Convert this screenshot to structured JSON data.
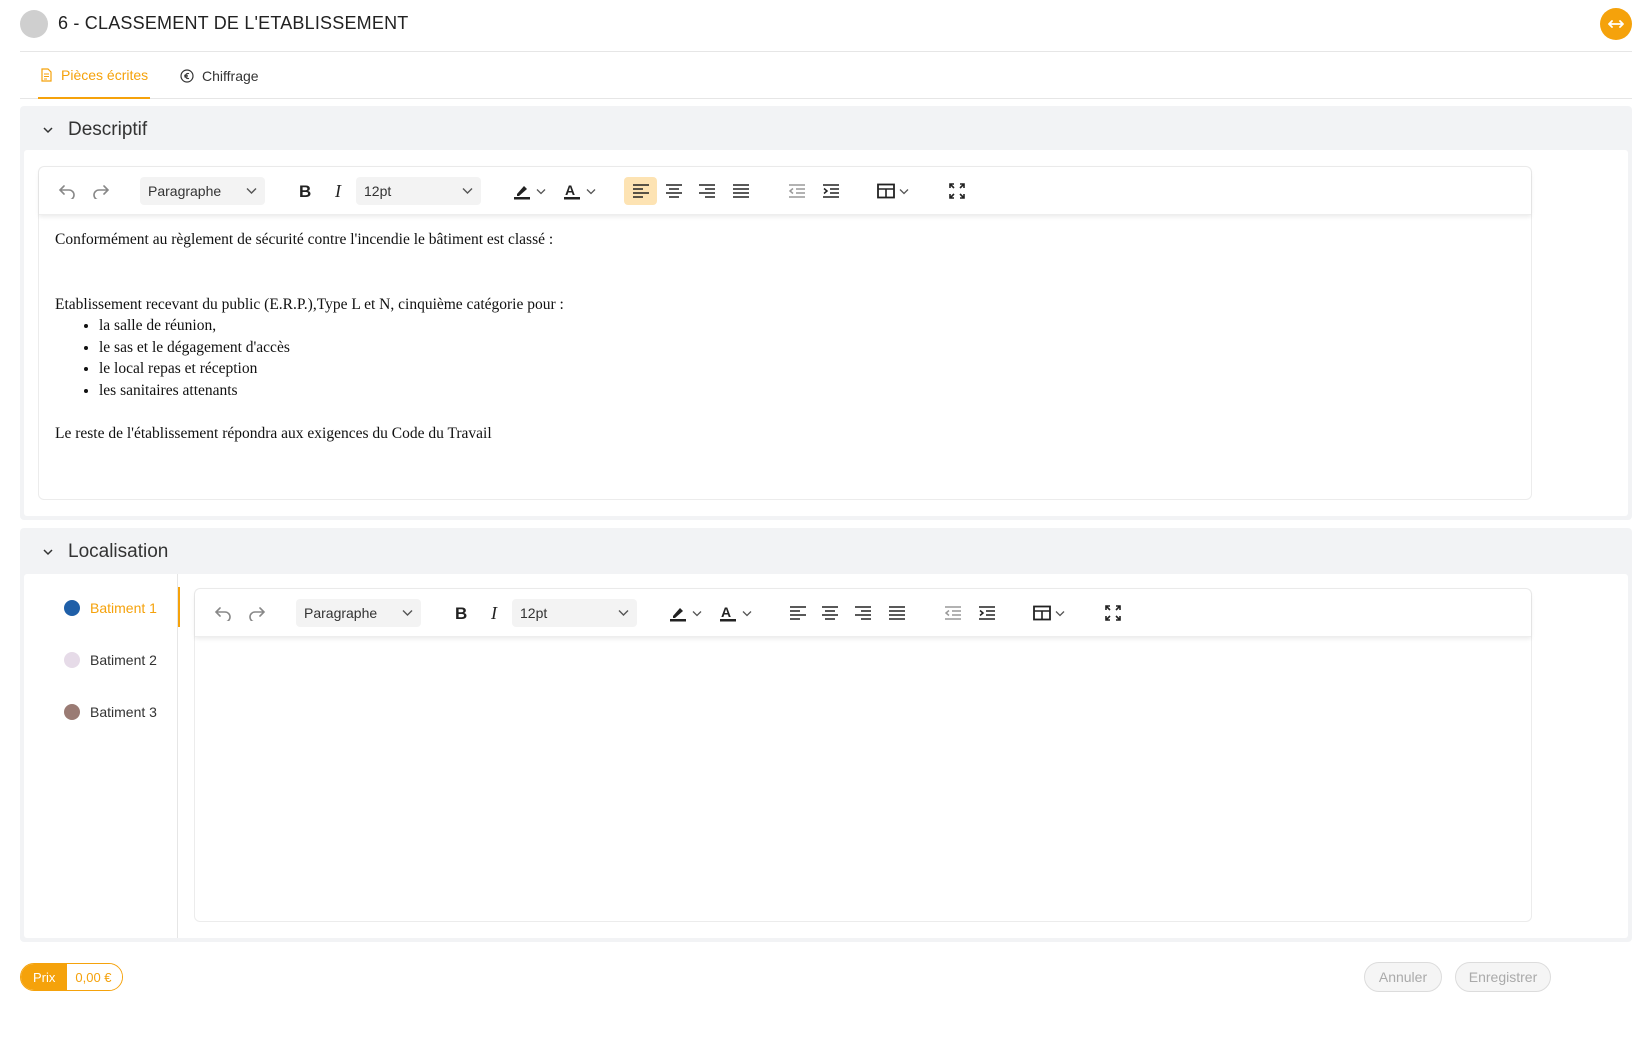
{
  "header": {
    "title": "6 - CLASSEMENT DE L'ETABLISSEMENT",
    "status_color": "#cfcfcf",
    "expand_icon": "horizontal-arrows-icon"
  },
  "tabs": [
    {
      "label": "Pièces écrites",
      "icon": "document-icon",
      "active": true
    },
    {
      "label": "Chiffrage",
      "icon": "euro-circle-icon",
      "active": false
    }
  ],
  "descriptif": {
    "title": "Descriptif",
    "toolbar": {
      "block_format": "Paragraphe",
      "font_size": "12pt"
    },
    "content": {
      "line1": "Conformément au règlement de sécurité contre l'incendie  le bâtiment est classé :",
      "line2": "Etablissement recevant du public (E.R.P.),Type L et N, cinquième catégorie pour :",
      "bullets": [
        "la salle de réunion,",
        "le sas et le dégagement d'accès",
        "le local repas et réception",
        "les sanitaires attenants"
      ],
      "line3": "Le reste de l'établissement répondra aux exigences du Code du Travail"
    }
  },
  "localisation": {
    "title": "Localisation",
    "batiments": [
      {
        "label": "Batiment 1",
        "color": "#1f5fa8",
        "active": true
      },
      {
        "label": "Batiment 2",
        "color": "#e6dbe8",
        "active": false
      },
      {
        "label": "Batiment 3",
        "color": "#9a7b74",
        "active": false
      }
    ],
    "toolbar": {
      "block_format": "Paragraphe",
      "font_size": "12pt"
    }
  },
  "footer": {
    "price_label": "Prix",
    "price_value": "0,00 €",
    "cancel_label": "Annuler",
    "save_label": "Enregistrer"
  },
  "colors": {
    "accent": "#f5a20b",
    "panel_bg": "#f2f3f5"
  }
}
